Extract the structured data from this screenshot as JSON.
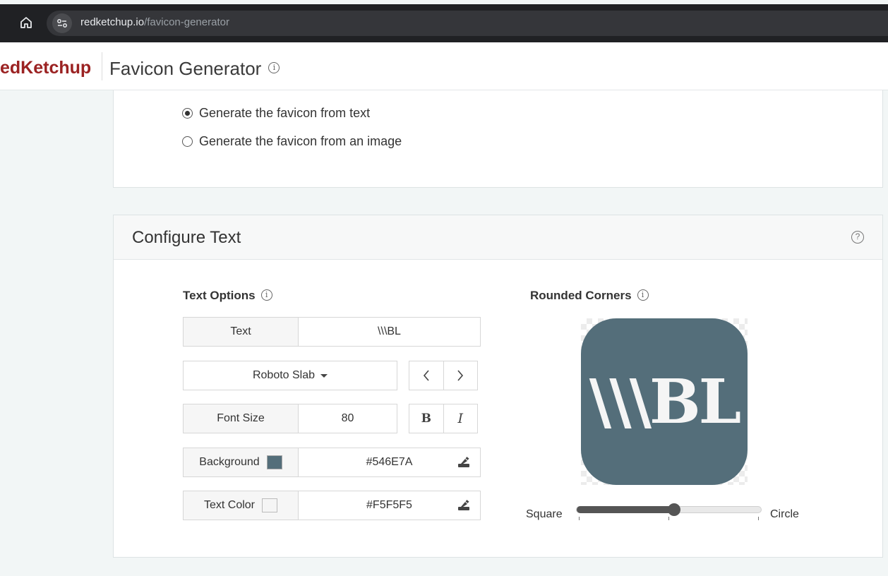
{
  "browser": {
    "url_host": "redketchup.io",
    "url_path": "/favicon-generator"
  },
  "header": {
    "brand": "edKetchup",
    "title": "Favicon Generator"
  },
  "source_options": [
    {
      "label": "Generate the favicon from text",
      "selected": true
    },
    {
      "label": "Generate the favicon from an image",
      "selected": false
    }
  ],
  "configure": {
    "title": "Configure Text",
    "text_options_heading": "Text Options",
    "rounded_corners_heading": "Rounded Corners",
    "text_label": "Text",
    "text_value": "\\\\\\BL",
    "font_name": "Roboto Slab",
    "font_size_label": "Font Size",
    "font_size_value": "80",
    "bold_label": "B",
    "italic_label": "I",
    "prev_font_label": "‹",
    "next_font_label": "›",
    "background_label": "Background",
    "background_value": "#546E7A",
    "text_color_label": "Text Color",
    "text_color_value": "#F5F5F5",
    "slider_left_label": "Square",
    "slider_right_label": "Circle",
    "corner_rounding": 0.53
  },
  "colors": {
    "background": "#546E7A",
    "text": "#F5F5F5",
    "brand": "#9b2222"
  },
  "icons": [
    "home-icon",
    "site-settings-icon",
    "info-icon",
    "help-icon",
    "eyedropper-icon",
    "chevron-left-icon",
    "chevron-right-icon",
    "dropdown-caret-icon"
  ]
}
